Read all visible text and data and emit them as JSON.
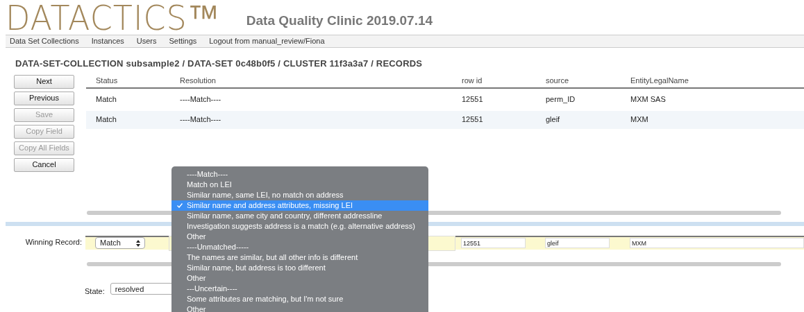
{
  "header": {
    "logo": "DATACTICS™",
    "title": "Data Quality Clinic 2019.07.14"
  },
  "nav": [
    "Data Set Collections",
    "Instances",
    "Users",
    "Settings",
    "Logout from manual_review/Fiona"
  ],
  "breadcrumb": "DATA-SET-COLLECTION subsample2 / DATA-SET 0c48b0f5 / CLUSTER 11f3a3a7 / RECORDS",
  "buttons": [
    {
      "label": "Next",
      "disabled": false
    },
    {
      "label": "Previous",
      "disabled": false
    },
    {
      "label": "Save",
      "disabled": true
    },
    {
      "label": "Copy Field",
      "disabled": true
    },
    {
      "label": "Copy All Fields",
      "disabled": true
    },
    {
      "label": "Cancel",
      "disabled": false
    }
  ],
  "table": {
    "columns": [
      "Status",
      "Resolution",
      "row id",
      "source",
      "EntityLegalName"
    ],
    "rows": [
      {
        "cells": [
          "Match",
          "----Match----",
          "12551",
          "perm_ID",
          "MXM SAS"
        ]
      },
      {
        "cells": [
          "Match",
          "----Match----",
          "12551",
          "gleif",
          "MXM"
        ]
      }
    ]
  },
  "winning_record": {
    "label": "Winning Record:",
    "status": "Match",
    "row_id": "12551",
    "source": "gleif",
    "entity_legal_name": "MXM"
  },
  "state": {
    "label": "State:",
    "value": "resolved"
  },
  "resolution_menu": [
    {
      "label": "----Match----",
      "selected": false
    },
    {
      "label": "Match on LEI",
      "selected": false
    },
    {
      "label": "Similar name, same LEI, no match on address",
      "selected": false
    },
    {
      "label": "Similar name and address attributes, missing LEI",
      "selected": true
    },
    {
      "label": "Similar name, same city and country, different addressline",
      "selected": false
    },
    {
      "label": "Investigation suggests address is a match (e.g. alternative address)",
      "selected": false
    },
    {
      "label": "Other",
      "selected": false
    },
    {
      "label": "----Unmatched-----",
      "selected": false
    },
    {
      "label": "The names are similar, but all other info is different",
      "selected": false
    },
    {
      "label": "Similar name, but address is too different",
      "selected": false
    },
    {
      "label": "Other",
      "selected": false
    },
    {
      "label": "---Uncertain----",
      "selected": false
    },
    {
      "label": "Some attributes are matching, but I'm not sure",
      "selected": false
    },
    {
      "label": "Other",
      "selected": false
    }
  ]
}
